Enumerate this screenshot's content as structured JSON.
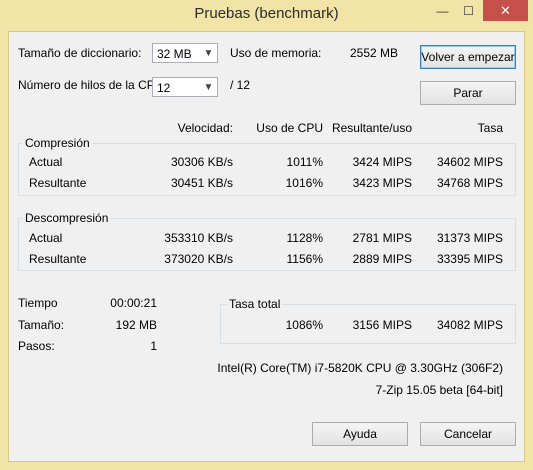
{
  "window": {
    "title": "Pruebas (benchmark)",
    "minimize_glyph": "—",
    "maximize_glyph": "☐",
    "close_glyph": "✕"
  },
  "settings": {
    "dict_label": "Tamaño de diccionario:",
    "dict_value": "32 MB",
    "memory_label": "Uso de memoria:",
    "memory_value": "2552 MB",
    "threads_label": "Número de hilos de la CPU:",
    "threads_value": "12",
    "threads_total": "/ 12"
  },
  "buttons": {
    "restart": "Volver a empezar",
    "stop": "Parar",
    "help": "Ayuda",
    "cancel": "Cancelar"
  },
  "columns": {
    "speed": "Velocidad:",
    "cpu": "Uso de CPU",
    "rating_usage": "Resultante/uso",
    "rate": "Tasa"
  },
  "compression": {
    "label": "Compresión",
    "rows": [
      {
        "name": "Actual",
        "speed": "30306 KB/s",
        "cpu": "1011%",
        "rating": "3424 MIPS",
        "rate": "34602 MIPS"
      },
      {
        "name": "Resultante",
        "speed": "30451 KB/s",
        "cpu": "1016%",
        "rating": "3423 MIPS",
        "rate": "34768 MIPS"
      }
    ]
  },
  "decompression": {
    "label": "Descompresión",
    "rows": [
      {
        "name": "Actual",
        "speed": "353310 KB/s",
        "cpu": "1128%",
        "rating": "2781 MIPS",
        "rate": "31373 MIPS"
      },
      {
        "name": "Resultante",
        "speed": "373020 KB/s",
        "cpu": "1156%",
        "rating": "2889 MIPS",
        "rate": "33395 MIPS"
      }
    ]
  },
  "stats": {
    "time_label": "Tiempo",
    "time_value": "00:00:21",
    "size_label": "Tamaño:",
    "size_value": "192 MB",
    "passes_label": "Pasos:",
    "passes_value": "1"
  },
  "total": {
    "label": "Tasa total",
    "cpu": "1086%",
    "rating": "3156 MIPS",
    "rate": "34082 MIPS"
  },
  "system": {
    "cpu_info": "Intel(R) Core(TM) i7-5820K CPU @ 3.30GHz (306F2)",
    "version": "7-Zip 15.05 beta [64-bit]"
  }
}
